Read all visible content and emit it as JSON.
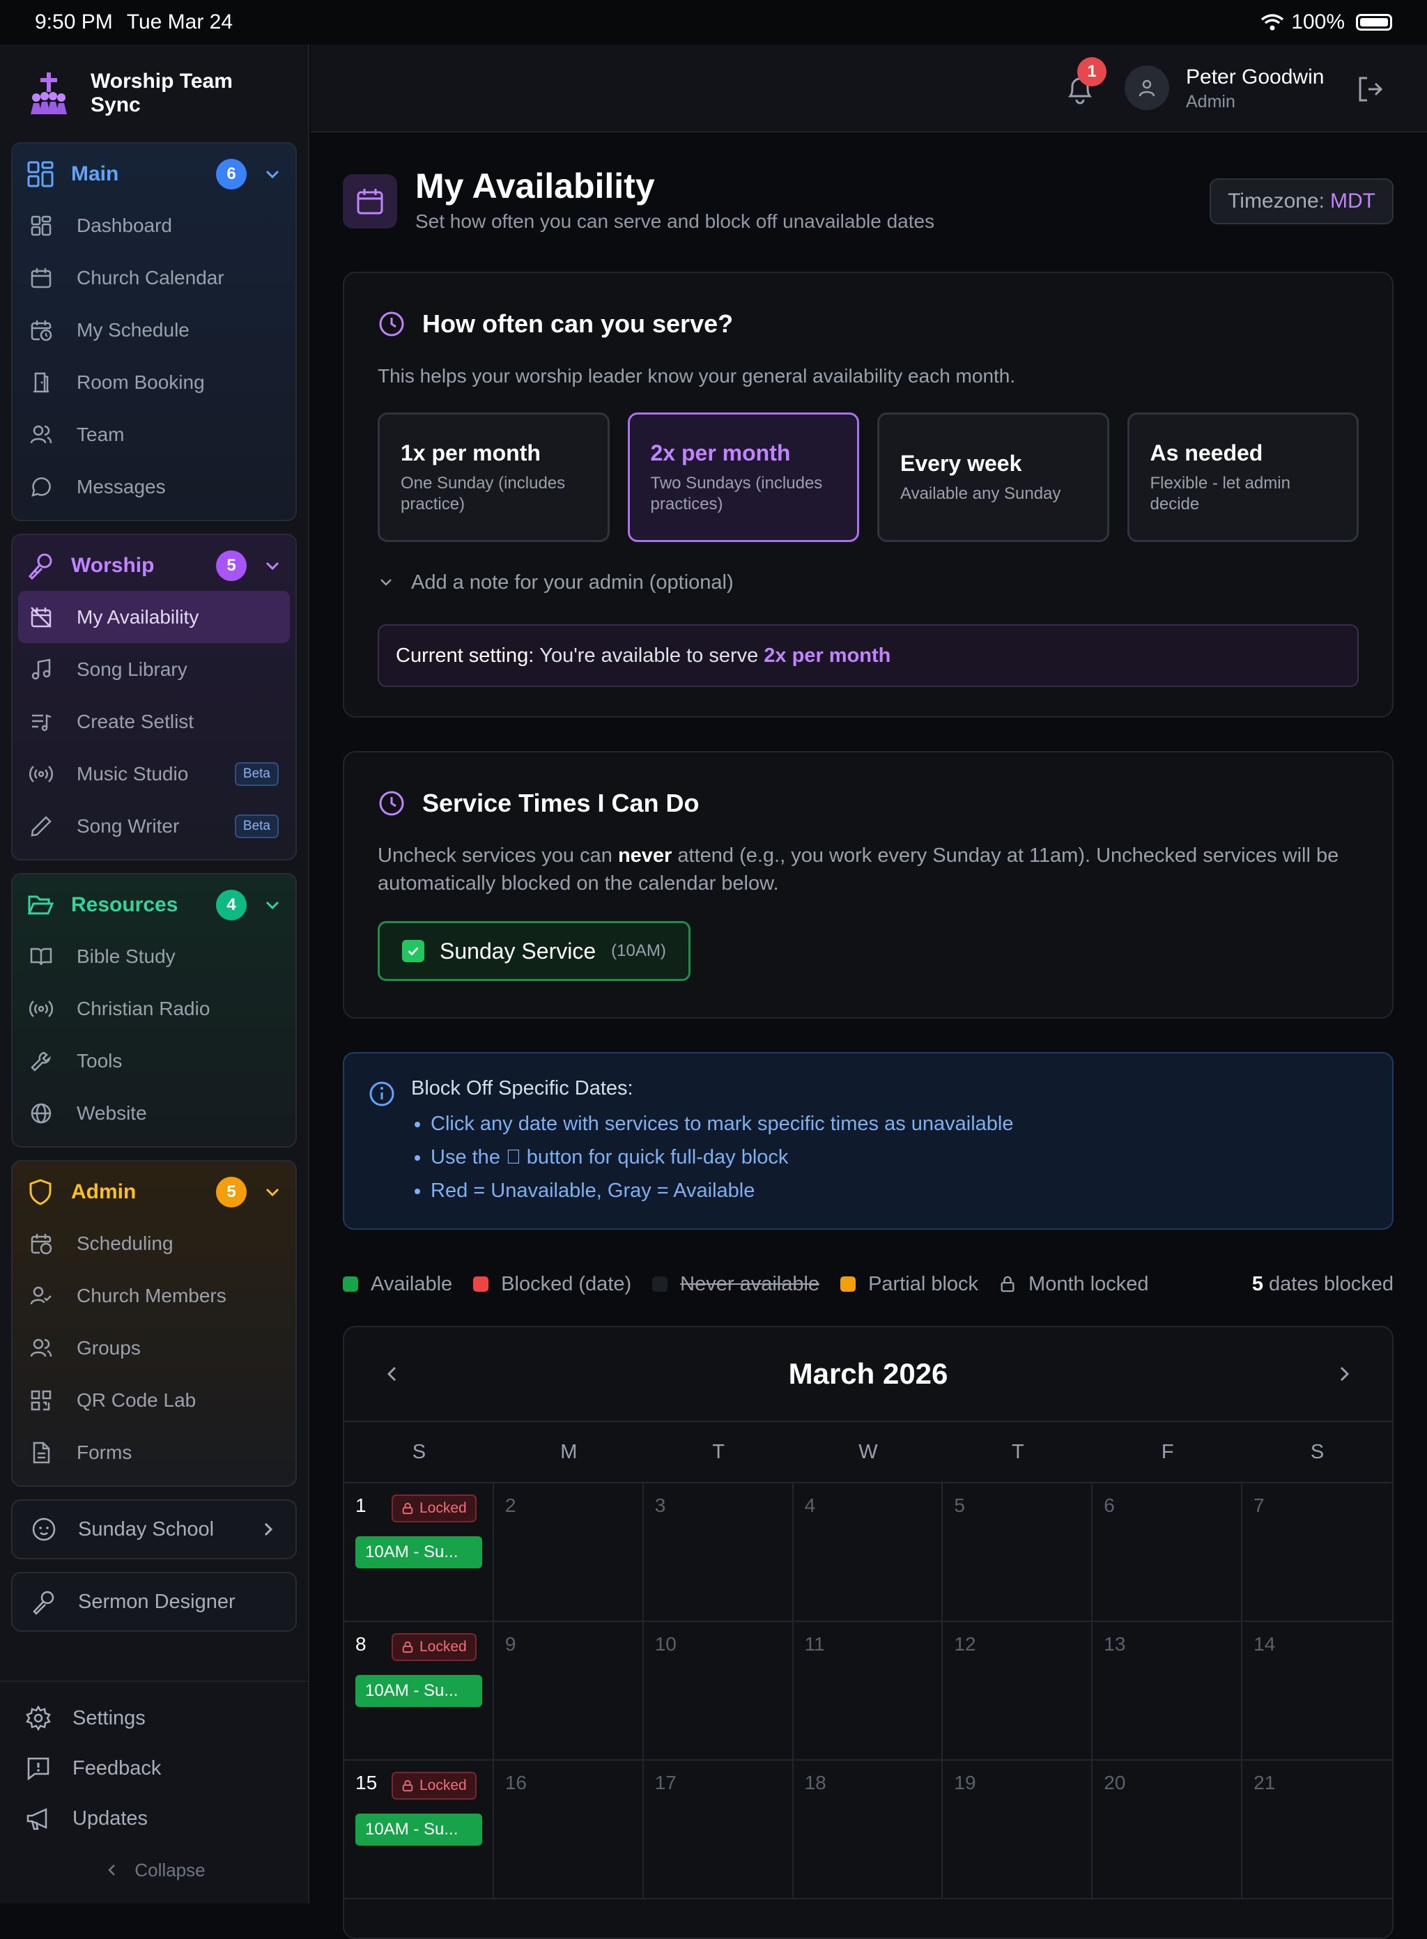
{
  "status": {
    "time": "9:50 PM",
    "date": "Tue Mar 24",
    "battery": "100%"
  },
  "app": {
    "name": "Worship Team Sync"
  },
  "sidebar": {
    "main": {
      "title": "Main",
      "badge": "6",
      "items": [
        "Dashboard",
        "Church Calendar",
        "My Schedule",
        "Room Booking",
        "Team",
        "Messages"
      ]
    },
    "worship": {
      "title": "Worship",
      "badge": "5",
      "items": [
        "My Availability",
        "Song Library",
        "Create Setlist",
        "Music Studio",
        "Song Writer"
      ],
      "beta_label": "Beta"
    },
    "resources": {
      "title": "Resources",
      "badge": "4",
      "items": [
        "Bible Study",
        "Christian Radio",
        "Tools",
        "Website"
      ]
    },
    "admin": {
      "title": "Admin",
      "badge": "5",
      "items": [
        "Scheduling",
        "Church Members",
        "Groups",
        "QR Code Lab",
        "Forms"
      ]
    },
    "sunday_school": "Sunday School",
    "sermon_designer": "Sermon Designer",
    "bottom": [
      "Settings",
      "Feedback",
      "Updates"
    ],
    "collapse": "Collapse"
  },
  "topbar": {
    "notifications": "1",
    "user_name": "Peter Goodwin",
    "user_role": "Admin"
  },
  "page": {
    "title": "My Availability",
    "subtitle": "Set how often you can serve and block off unavailable dates",
    "timezone_label": "Timezone:",
    "timezone_value": "MDT"
  },
  "frequency": {
    "title": "How often can you serve?",
    "desc": "This helps your worship leader know your general availability each month.",
    "options": [
      {
        "title": "1x per month",
        "desc": "One Sunday (includes practice)"
      },
      {
        "title": "2x per month",
        "desc": "Two Sundays (includes practices)"
      },
      {
        "title": "Every week",
        "desc": "Available any Sunday"
      },
      {
        "title": "As needed",
        "desc": "Flexible - let admin decide"
      }
    ],
    "note_toggle": "Add a note for your admin (optional)",
    "current_label": "Current setting:",
    "current_text": "You're available to serve",
    "current_value": "2x per month"
  },
  "services": {
    "title": "Service Times I Can Do",
    "desc_before": "Uncheck services you can ",
    "desc_bold": "never",
    "desc_after": " attend (e.g., you work every Sunday at 11am). Unchecked services will be automatically blocked on the calendar below.",
    "service_name": "Sunday Service",
    "service_time": "(10AM)"
  },
  "info": {
    "title": "Block Off Specific Dates:",
    "bullets": [
      "Click any date with services to mark specific times as unavailable",
      "Use the ⃠ button for quick full-day block",
      "Red = Unavailable, Gray = Available"
    ]
  },
  "legend": {
    "available": "Available",
    "blocked": "Blocked (date)",
    "never": "Never available",
    "partial": "Partial block",
    "locked": "Month locked",
    "count": "5",
    "count_suffix": "dates blocked"
  },
  "colors": {
    "available": "#16a34a",
    "blocked": "#ef4444",
    "partial": "#f59e0b",
    "accent": "#c084fc"
  },
  "calendar": {
    "month": "March 2026",
    "dow": [
      "S",
      "M",
      "T",
      "W",
      "T",
      "F",
      "S"
    ],
    "weeks": [
      [
        "1",
        "2",
        "3",
        "4",
        "5",
        "6",
        "7"
      ],
      [
        "8",
        "9",
        "10",
        "11",
        "12",
        "13",
        "14"
      ],
      [
        "15",
        "16",
        "17",
        "18",
        "19",
        "20",
        "21"
      ]
    ],
    "locked_label": "Locked",
    "event_label": "10AM - Su..."
  }
}
